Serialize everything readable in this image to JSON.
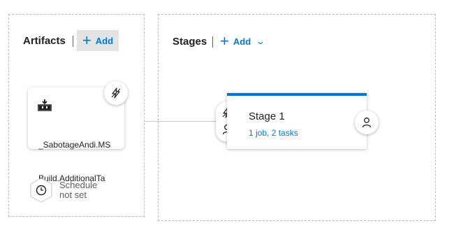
{
  "artifacts": {
    "title": "Artifacts",
    "add_label": "Add",
    "card": {
      "name_line1": "_SabotageAndi.MS",
      "name_line2": "Build.AdditionalTa",
      "icon": "build-pipeline-icon",
      "trigger_icon": "lightning-icon"
    },
    "schedule": {
      "line1": "Schedule",
      "line2": "not set",
      "icon": "clock-icon"
    }
  },
  "stages": {
    "title": "Stages",
    "add_label": "Add",
    "add_dropdown_icon": "chevron-down-icon",
    "stage": {
      "name": "Stage 1",
      "tasks": "1 job, 2 tasks",
      "accent_color": "#0078d4"
    },
    "pre_deployment_icons": [
      "lightning-icon",
      "person-icon"
    ],
    "post_deployment_icon": "person-icon"
  },
  "colors": {
    "accent": "#0078d4",
    "text": "#201f1e",
    "muted": "#605e5c"
  }
}
